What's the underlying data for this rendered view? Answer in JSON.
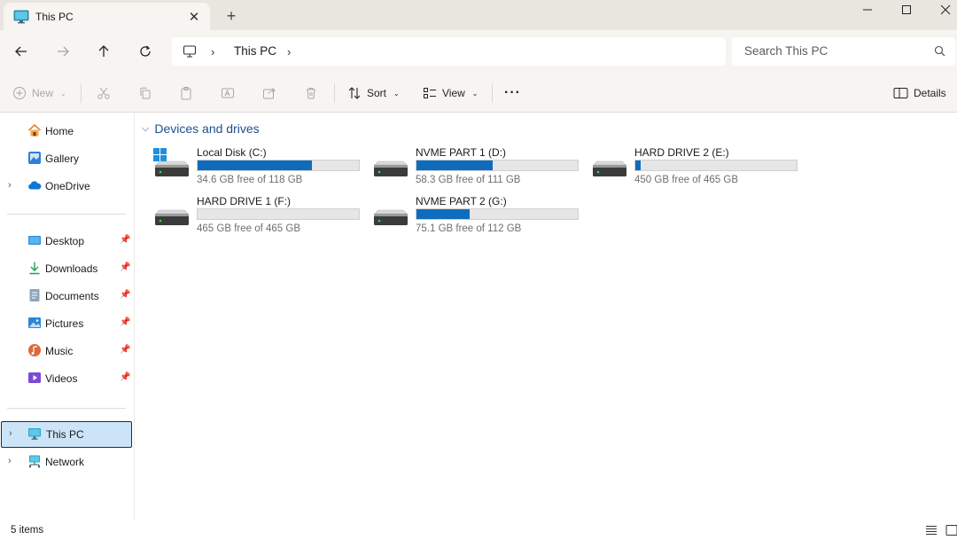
{
  "window": {
    "tab_title": "This PC",
    "tab_close_glyph": "✕",
    "new_tab_glyph": "+",
    "icons": [
      "monitor-icon",
      "close-icon",
      "plus-icon",
      "minimize-icon",
      "maximize-icon",
      "window-close-icon"
    ]
  },
  "address": {
    "crumb": "This PC",
    "search_placeholder": "Search This PC"
  },
  "commands": {
    "new_label": "New",
    "sort_label": "Sort",
    "view_label": "View",
    "more_label": "···",
    "details_label": "Details"
  },
  "sidebar": {
    "top": [
      {
        "label": "Home",
        "icon": "home-icon"
      },
      {
        "label": "Gallery",
        "icon": "gallery-icon"
      },
      {
        "label": "OneDrive",
        "icon": "onedrive-cloud-icon"
      }
    ],
    "quick": [
      {
        "label": "Desktop",
        "icon": "desktop-icon"
      },
      {
        "label": "Downloads",
        "icon": "download-icon"
      },
      {
        "label": "Documents",
        "icon": "documents-icon"
      },
      {
        "label": "Pictures",
        "icon": "pictures-icon"
      },
      {
        "label": "Music",
        "icon": "music-icon"
      },
      {
        "label": "Videos",
        "icon": "videos-icon"
      }
    ],
    "bottom": [
      {
        "label": "This PC",
        "icon": "this-pc-icon",
        "selected": true
      },
      {
        "label": "Network",
        "icon": "network-icon"
      }
    ]
  },
  "content": {
    "group_title": "Devices and drives",
    "drives": [
      {
        "name": "Local Disk (C:)",
        "free_text": "34.6 GB free of 118 GB",
        "used_fraction": 0.707,
        "system": true
      },
      {
        "name": "NVME PART 1 (D:)",
        "free_text": "58.3 GB free of 111 GB",
        "used_fraction": 0.475
      },
      {
        "name": "HARD DRIVE 2 (E:)",
        "free_text": "450 GB free of 465 GB",
        "used_fraction": 0.032
      },
      {
        "name": "HARD DRIVE 1 (F:)",
        "free_text": "465 GB free of 465 GB",
        "used_fraction": 0.0
      },
      {
        "name": "NVME PART 2 (G:)",
        "free_text": "75.1 GB free of 112 GB",
        "used_fraction": 0.329
      }
    ]
  },
  "status": {
    "item_count": "5 items"
  },
  "colors": {
    "accent": "#0f6cbd",
    "selected_bg": "#cce4f7",
    "group_heading": "#1f4e8c"
  }
}
